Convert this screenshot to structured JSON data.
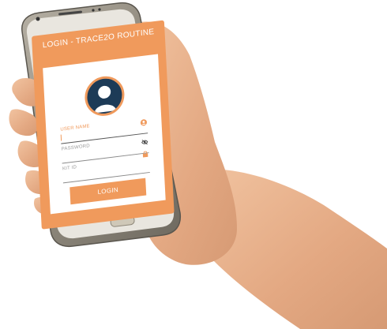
{
  "app": {
    "title": "LOGIN - TRACE2O ROUTINE"
  },
  "form": {
    "username": {
      "label": "USER NAME",
      "value": ""
    },
    "password": {
      "label": "PASSWORD",
      "value": ""
    },
    "kit_id": {
      "label": "KIT ID",
      "value": ""
    },
    "login_label": "LOGIN"
  },
  "colors": {
    "accent": "#f09a5c",
    "avatar_bg": "#1d3b57",
    "phone_frame": "#8c8579",
    "skin": "#e6b08b"
  },
  "icons": [
    "user-icon",
    "eye-off-icon",
    "lock-icon",
    "avatar-icon",
    "home-button"
  ]
}
